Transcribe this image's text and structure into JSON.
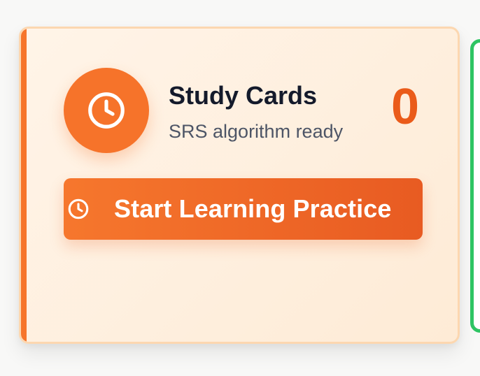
{
  "card": {
    "title": "Study Cards",
    "subtitle": "SRS algorithm ready",
    "count": "0",
    "icon": "clock-icon",
    "button": {
      "label": "Start Learning Practice",
      "icon": "clock-icon"
    }
  },
  "colors": {
    "accent": "#f6732a",
    "count": "#ea5b1a",
    "card_background": "#fff4e8",
    "card_border": "#fcd7b0",
    "title": "#141a2b",
    "subtitle": "#4d5566",
    "adjacent_card_border": "#2ec463"
  }
}
